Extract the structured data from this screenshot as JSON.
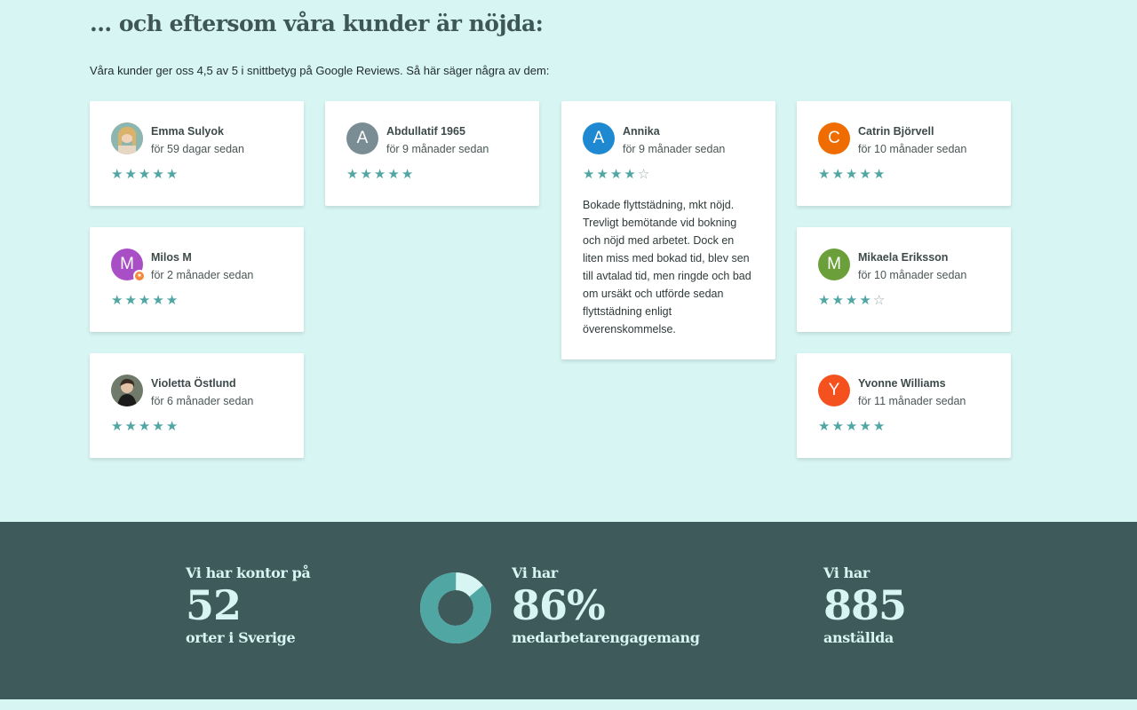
{
  "heading": "... och eftersom våra kunder är nöjda:",
  "intro": "Våra kunder ger oss 4,5 av 5 i snittbetyg på Google Reviews. Så här säger några av dem:",
  "colors": {
    "background": "#d7f5f3",
    "accent": "#4fa6a3",
    "stats_band": "#3f5a5b"
  },
  "reviews": [
    {
      "name": "Emma Sulyok",
      "time": "för 59 dagar sedan",
      "rating": 5,
      "avatar": "photo"
    },
    {
      "name": "Milos M",
      "time": "för 2 månader sedan",
      "rating": 5,
      "avatar_letter": "M",
      "avatar_color": "#a94fc6"
    },
    {
      "name": "Violetta Östlund",
      "time": "för 6 månader sedan",
      "rating": 5,
      "avatar": "photo"
    },
    {
      "name": "Abdullatif 1965",
      "time": "för 9 månader sedan",
      "rating": 5,
      "avatar_letter": "A",
      "avatar_color": "#7a8c94"
    },
    {
      "name": "Annika",
      "time": "för 9 månader sedan",
      "rating": 4,
      "avatar_letter": "A",
      "avatar_color": "#1e88d0",
      "text": "Bokade flyttstädning, mkt nöjd. Trevligt bemötande vid bokning och nöjd med arbetet. Dock en liten miss med bokad tid, blev sen till avtalad tid, men ringde och bad om ursäkt och utförde sedan flyttstädning enligt överenskommelse."
    },
    {
      "name": "Catrin Björvell",
      "time": "för 10 månader sedan",
      "rating": 5,
      "avatar_letter": "C",
      "avatar_color": "#ef6c00"
    },
    {
      "name": "Mikaela Eriksson",
      "time": "för 10 månader sedan",
      "rating": 4,
      "avatar_letter": "M",
      "avatar_color": "#6a9f3a"
    },
    {
      "name": "Yvonne Williams",
      "time": "för 11 månader sedan",
      "rating": 5,
      "avatar_letter": "Y",
      "avatar_color": "#f4511e"
    }
  ],
  "stats": {
    "offices": {
      "pre": "Vi har kontor på",
      "value": "52",
      "post": "orter i Sverige"
    },
    "engagement": {
      "pre": "Vi har",
      "value": "86%",
      "post": "medarbetarengagemang",
      "percent": 86
    },
    "employees": {
      "pre": "Vi har",
      "value": "885",
      "post": "anställda"
    }
  }
}
